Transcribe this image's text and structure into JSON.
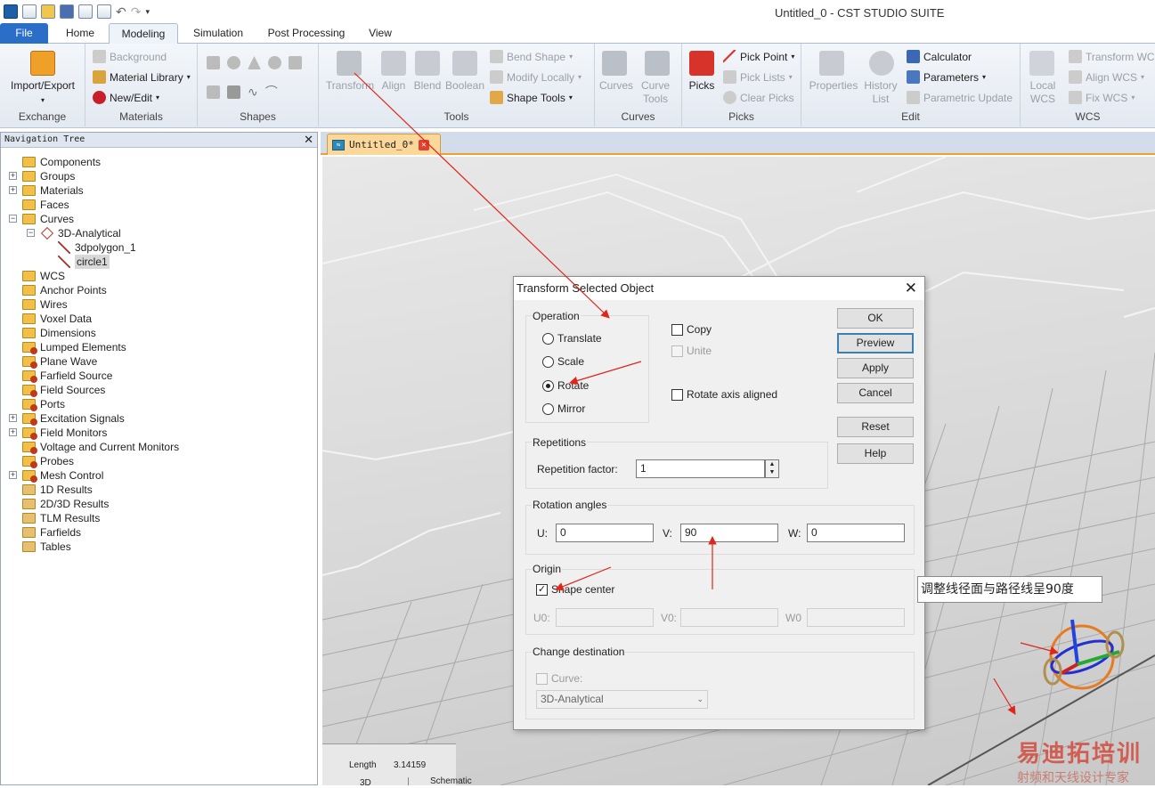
{
  "app": {
    "title": "Untitled_0 - CST STUDIO SUITE"
  },
  "tabs": [
    {
      "label": "File"
    },
    {
      "label": "Home"
    },
    {
      "label": "Modeling"
    },
    {
      "label": "Simulation"
    },
    {
      "label": "Post Processing"
    },
    {
      "label": "View"
    }
  ],
  "ribbon": {
    "exchange": {
      "label": "Exchange",
      "import_export": "Import/Export"
    },
    "materials": {
      "label": "Materials",
      "background": "Background",
      "material_library": "Material Library",
      "new_edit": "New/Edit"
    },
    "shapes": {
      "label": "Shapes"
    },
    "tools": {
      "label": "Tools",
      "transform": "Transform",
      "align": "Align",
      "blend": "Blend",
      "boolean": "Boolean",
      "bend_shape": "Bend Shape",
      "modify_locally": "Modify Locally",
      "shape_tools": "Shape Tools"
    },
    "curves": {
      "label": "Curves",
      "curves": "Curves",
      "curve_tools_1": "Curve",
      "curve_tools_2": "Tools"
    },
    "picks": {
      "label": "Picks",
      "picks": "Picks",
      "pick_point": "Pick Point",
      "pick_lists": "Pick Lists",
      "clear_picks": "Clear Picks"
    },
    "edit": {
      "label": "Edit",
      "properties": "Properties",
      "history_1": "History",
      "history_2": "List",
      "calculator": "Calculator",
      "parameters": "Parameters",
      "parametric_update": "Parametric Update"
    },
    "wcs": {
      "label": "WCS",
      "local_1": "Local",
      "local_2": "WCS",
      "transform_wcs": "Transform WCS",
      "align_wcs": "Align WCS",
      "fix_wcs": "Fix WCS"
    }
  },
  "nav": {
    "title": "Navigation Tree",
    "items": [
      {
        "label": "Components"
      },
      {
        "label": "Groups"
      },
      {
        "label": "Materials"
      },
      {
        "label": "Faces"
      },
      {
        "label": "Curves"
      },
      {
        "label": "3D-Analytical"
      },
      {
        "label": "3dpolygon_1"
      },
      {
        "label": "circle1"
      },
      {
        "label": "WCS"
      },
      {
        "label": "Anchor Points"
      },
      {
        "label": "Wires"
      },
      {
        "label": "Voxel Data"
      },
      {
        "label": "Dimensions"
      },
      {
        "label": "Lumped Elements"
      },
      {
        "label": "Plane Wave"
      },
      {
        "label": "Farfield Source"
      },
      {
        "label": "Field Sources"
      },
      {
        "label": "Ports"
      },
      {
        "label": "Excitation Signals"
      },
      {
        "label": "Field Monitors"
      },
      {
        "label": "Voltage and Current Monitors"
      },
      {
        "label": "Probes"
      },
      {
        "label": "Mesh Control"
      },
      {
        "label": "1D Results"
      },
      {
        "label": "2D/3D Results"
      },
      {
        "label": "TLM Results"
      },
      {
        "label": "Farfields"
      },
      {
        "label": "Tables"
      }
    ]
  },
  "doc_tab": {
    "label": "Untitled_0*"
  },
  "dialog": {
    "title": "Transform Selected Object",
    "operation": {
      "label": "Operation",
      "translate": "Translate",
      "scale": "Scale",
      "rotate": "Rotate",
      "mirror": "Mirror",
      "selected": "Rotate"
    },
    "copy": "Copy",
    "unite": "Unite",
    "rotate_axis_aligned": "Rotate axis aligned",
    "buttons": {
      "ok": "OK",
      "preview": "Preview",
      "apply": "Apply",
      "cancel": "Cancel",
      "reset": "Reset",
      "help": "Help"
    },
    "repetitions": {
      "label": "Repetitions",
      "factor_label": "Repetition factor:",
      "factor": "1"
    },
    "rotation": {
      "label": "Rotation angles",
      "u_label": "U:",
      "u": "0",
      "v_label": "V:",
      "v": "90",
      "w_label": "W:",
      "w": "0"
    },
    "origin": {
      "label": "Origin",
      "shape_center": "Shape center",
      "shape_center_checked": true,
      "u0_label": "U0:",
      "v0_label": "V0:",
      "w0_label": "W0"
    },
    "destination": {
      "label": "Change destination",
      "curve_label": "Curve:",
      "curve_value": "3D-Analytical"
    }
  },
  "annotation": "调整线径面与路径线呈90度",
  "status": {
    "length_label": "Length",
    "length_value": "3.14159",
    "tab_3d": "3D",
    "tab_schematic": "Schematic"
  },
  "watermark": {
    "line1": "易迪拓培训",
    "line2": "射频和天线设计专家"
  },
  "colors": {
    "file_tab": "#2a6ec8",
    "accent_orange": "#f0a030",
    "arrow_red": "#e0261a"
  }
}
